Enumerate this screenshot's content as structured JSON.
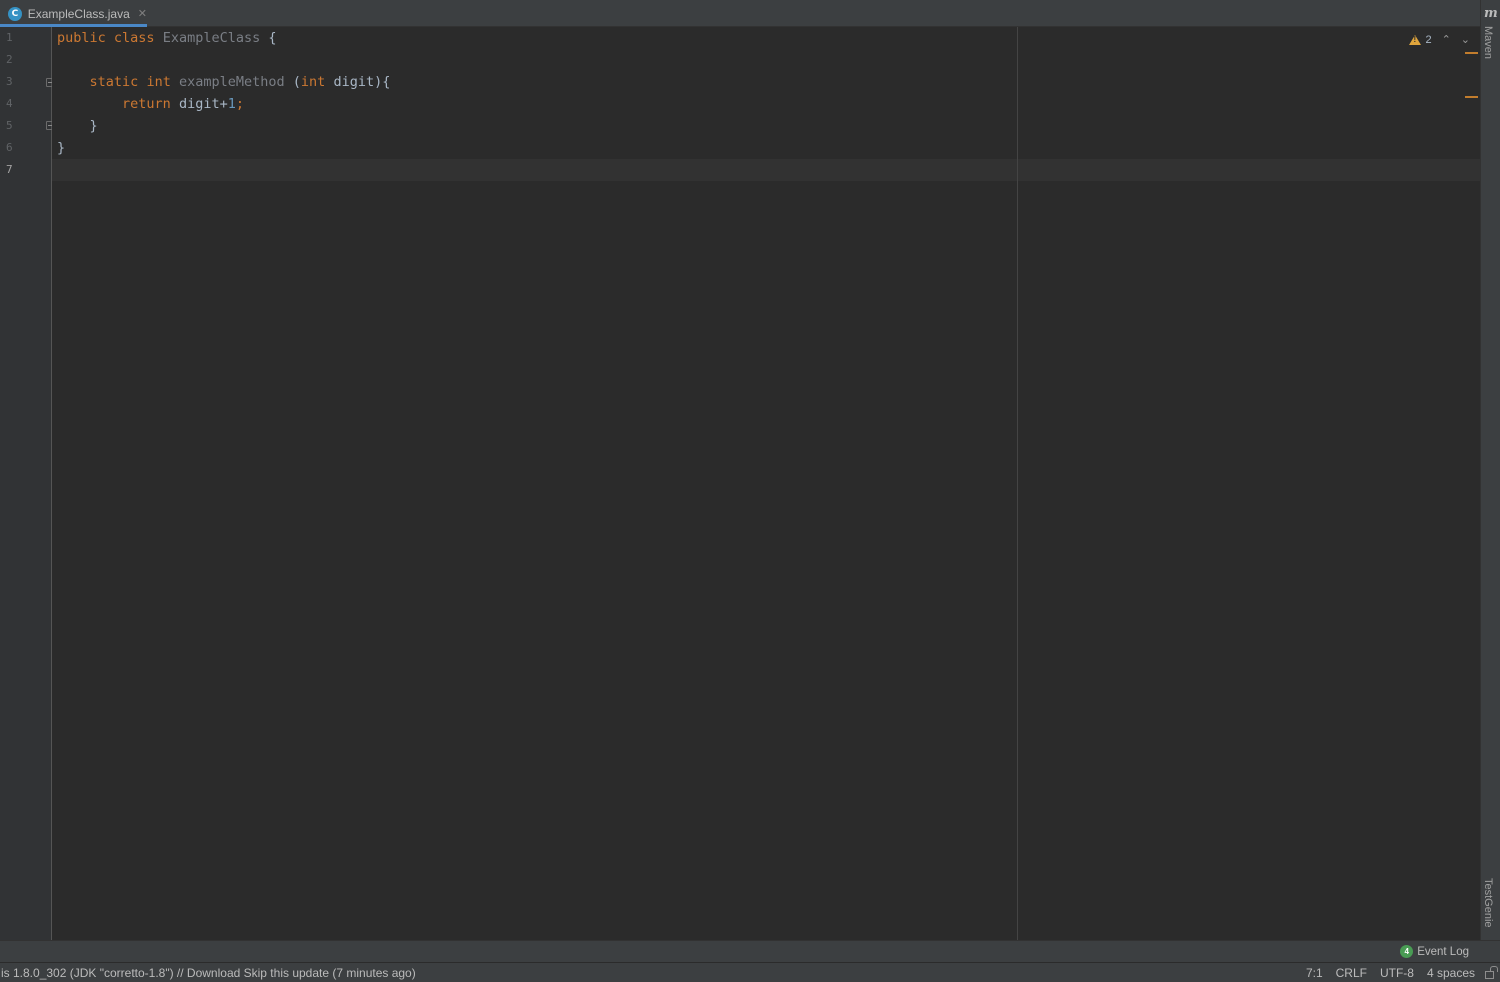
{
  "tabs": [
    {
      "label": "ExampleClass.java",
      "icon": "java-class-icon",
      "icon_glyph": "C",
      "close_glyph": "✕"
    }
  ],
  "right_strip": {
    "maven_glyph": "m",
    "maven_label": "Maven",
    "testgenie_label": "TestGenie"
  },
  "gutter": {
    "line_numbers": [
      "1",
      "2",
      "3",
      "4",
      "5",
      "6",
      "7"
    ],
    "current_line": "7"
  },
  "code": {
    "line1": {
      "kw1": "public",
      "kw2": "class",
      "name": "ExampleClass",
      "brace": "{"
    },
    "line3": {
      "kw1": "static",
      "kw2": "int",
      "name": "exampleMethod",
      "params_open": "(",
      "param_type": "int",
      "param_name": "digit",
      "params_close": "){"
    },
    "line4": {
      "kw": "return",
      "expr": "digit+",
      "num": "1",
      "semi": ";"
    },
    "line5": {
      "brace": "}"
    },
    "line6": {
      "brace": "}"
    }
  },
  "inspection": {
    "warning_count": "2",
    "up_glyph": "⌃",
    "down_glyph": "⌄"
  },
  "event_log": {
    "count": "4",
    "label": "Event Log"
  },
  "status": {
    "message": "is 1.8.0_302 (JDK \"corretto-1.8\") // Download   Skip this update (7 minutes ago)",
    "position": "7:1",
    "line_separator": "CRLF",
    "encoding": "UTF-8",
    "indent": "4 spaces"
  },
  "colors": {
    "keyword": "#cc7832",
    "number": "#6897bb",
    "text": "#a9b7c6",
    "tab_accent": "#4a88c7",
    "warning": "#e0a53c"
  }
}
